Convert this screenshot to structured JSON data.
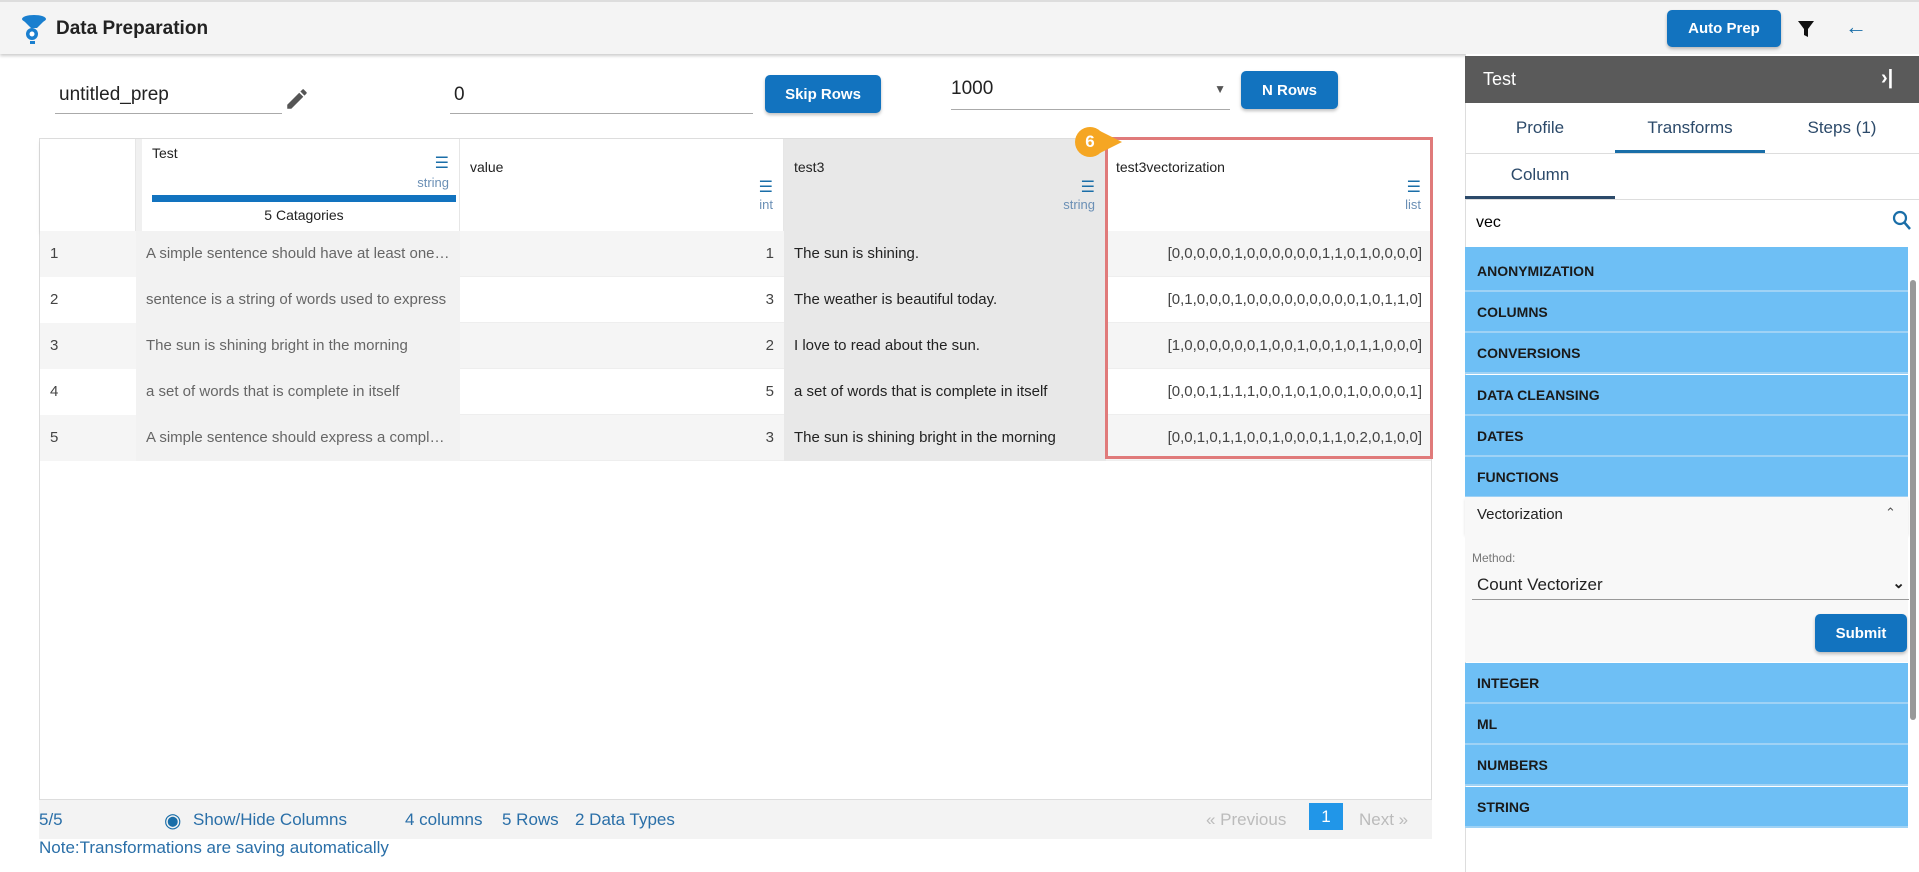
{
  "app": {
    "title": "Data Preparation",
    "auto_prep": "Auto Prep"
  },
  "toolbar": {
    "name": "untitled_prep",
    "skip_value": "0",
    "skip_label": "Skip Rows",
    "nrows_value": "1000",
    "nrows_label": "N Rows"
  },
  "table": {
    "columns": [
      {
        "name": "Test",
        "type": "string",
        "categories": "5 Catagories"
      },
      {
        "name": "value",
        "type": "int"
      },
      {
        "name": "test3",
        "type": "string"
      },
      {
        "name": "test3vectorization",
        "type": "list"
      }
    ],
    "rows": [
      {
        "idx": "1",
        "test": "A simple sentence should have at least one subject",
        "value": "1",
        "test3": "The sun is shining.",
        "vec": "[0,0,0,0,0,1,0,0,0,0,0,0,1,1,0,1,0,0,0,0]"
      },
      {
        "idx": "2",
        "test": "sentence is a string of words used to express",
        "value": "3",
        "test3": "The weather is beautiful today.",
        "vec": "[0,1,0,0,0,1,0,0,0,0,0,0,0,0,0,1,0,1,1,0]"
      },
      {
        "idx": "3",
        "test": "The sun is shining bright in the morning",
        "value": "2",
        "test3": "I love to read about the sun.",
        "vec": "[1,0,0,0,0,0,0,1,0,0,1,0,0,1,0,1,1,0,0,0]"
      },
      {
        "idx": "4",
        "test": "a set of words that is complete in itself",
        "value": "5",
        "test3": "a set of words that is complete in itself",
        "vec": "[0,0,0,1,1,1,1,0,0,1,0,1,0,0,1,0,0,0,0,1]"
      },
      {
        "idx": "5",
        "test": "A simple sentence should express a complete thought",
        "value": "3",
        "test3": "The sun is shining bright in the morning",
        "vec": "[0,0,1,0,1,1,0,0,1,0,0,0,1,1,0,2,0,1,0,0]"
      }
    ],
    "badge": "6"
  },
  "footer": {
    "count": "5/5",
    "show_hide": "Show/Hide Columns",
    "columns": "4 columns",
    "rows": "5 Rows",
    "types": "2 Data Types",
    "prev": "« Previous",
    "page": "1",
    "next": "Next »",
    "note": "Note:Transformations are saving automatically"
  },
  "panel": {
    "title": "Test",
    "tabs": [
      "Profile",
      "Transforms",
      "Steps (1)"
    ],
    "subtab": "Column",
    "search": "vec",
    "categories_top": [
      "ANONYMIZATION",
      "COLUMNS",
      "CONVERSIONS",
      "DATA CLEANSING",
      "DATES",
      "FUNCTIONS"
    ],
    "expanded": {
      "title": "Vectorization",
      "method_label": "Method:",
      "method_value": "Count Vectorizer",
      "submit": "Submit"
    },
    "categories_bottom": [
      "INTEGER",
      "ML",
      "NUMBERS",
      "STRING"
    ]
  },
  "colors": {
    "primary": "#1273bf",
    "category": "#6ebff5",
    "highlight": "#e07a7a",
    "badge": "#f5a623"
  }
}
